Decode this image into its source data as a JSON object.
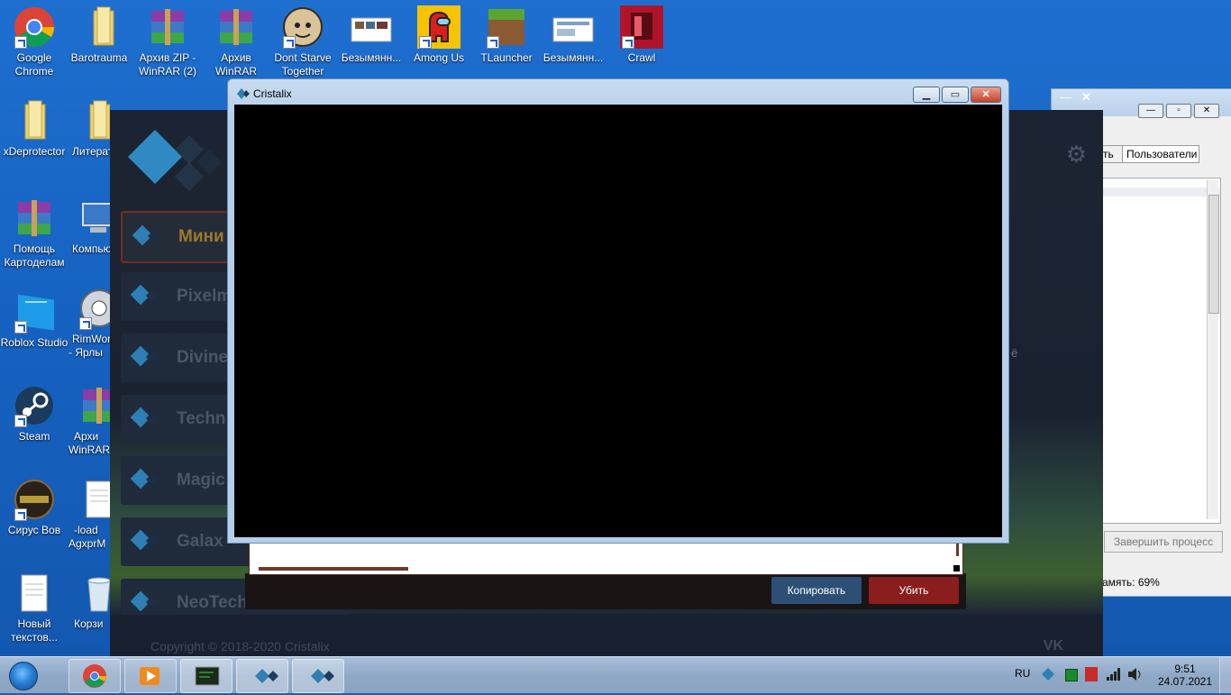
{
  "desktop": {
    "icons": [
      {
        "id": "chrome",
        "label": "Google Chrome",
        "icon": "chrome-icon"
      },
      {
        "id": "barotrauma",
        "label": "Barotrauma",
        "icon": "folder-icon"
      },
      {
        "id": "winrar-zip",
        "label": "Архив ZIP - WinRAR (2)",
        "icon": "winrar-icon"
      },
      {
        "id": "winrar",
        "label": "Архив WinRAR",
        "icon": "winrar-icon"
      },
      {
        "id": "dontstarve",
        "label": "Dont Starve Together",
        "icon": "dont-starve-icon"
      },
      {
        "id": "bezym1",
        "label": "Безымянн...",
        "icon": "image-icon"
      },
      {
        "id": "amongus",
        "label": "Among Us",
        "icon": "among-us-icon"
      },
      {
        "id": "tlauncher",
        "label": "TLauncher",
        "icon": "tlauncher-icon"
      },
      {
        "id": "bezym2",
        "label": "Безымянн...",
        "icon": "image-icon"
      },
      {
        "id": "crawl",
        "label": "Crawl",
        "icon": "crawl-icon"
      },
      {
        "id": "xdeprotector",
        "label": "xDeprotector",
        "icon": "folder-icon"
      },
      {
        "id": "literat",
        "label": "Литерат",
        "icon": "folder-icon"
      },
      {
        "id": "pomosch",
        "label": "Помощь Картоделам",
        "icon": "winrar-icon"
      },
      {
        "id": "komp",
        "label": "Компью",
        "icon": "computer-icon"
      },
      {
        "id": "roblox",
        "label": "Roblox Studio",
        "icon": "roblox-icon"
      },
      {
        "id": "rimworld",
        "label": "RimWor - Ярлы",
        "icon": "rimworld-icon"
      },
      {
        "id": "steam",
        "label": "Steam",
        "icon": "steam-icon"
      },
      {
        "id": "arhiv2",
        "label": "Архи WinRAR",
        "icon": "winrar-icon"
      },
      {
        "id": "sirus",
        "label": "Сирус Вов",
        "icon": "warcraft-icon"
      },
      {
        "id": "load",
        "label": "-load AgxprM",
        "icon": "text-file-icon"
      },
      {
        "id": "novyi",
        "label": "Новый текстов...",
        "icon": "text-file-icon"
      },
      {
        "id": "korz",
        "label": "Корзи",
        "icon": "recycle-bin-icon"
      }
    ]
  },
  "launcher": {
    "servers": [
      {
        "label": "Мини",
        "active": true
      },
      {
        "label": "Pixelm",
        "active": false
      },
      {
        "label": "Divine",
        "active": false
      },
      {
        "label": "Techn",
        "active": false
      },
      {
        "label": "Magic",
        "active": false
      },
      {
        "label": "Galax",
        "active": false
      },
      {
        "label": "NeoTech",
        "active": false
      }
    ],
    "copyright": "Copyright © 2018-2020 Cristalix",
    "vk": "VK",
    "side_text": "ё",
    "copy_button": "Копировать",
    "kill_button": "Убить"
  },
  "cristalix_window": {
    "title": "Cristalix",
    "min_icon": "minimize-icon",
    "max_icon": "maximize-icon",
    "close_icon": "close-icon"
  },
  "taskmgr": {
    "tab_partial": "ть",
    "tab_users": "Пользователи",
    "end_process": "Завершить процесс",
    "memory": "амять: 69%"
  },
  "taskbar": {
    "lang": "RU",
    "time": "9:51",
    "date": "24.07.2021"
  },
  "colors": {
    "accent": "#2f7fb5",
    "kill": "#8a1e1e",
    "copy": "#2d4f75"
  }
}
